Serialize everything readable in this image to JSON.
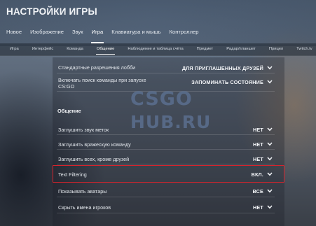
{
  "title": "НАСТРОЙКИ ИГРЫ",
  "tabs": [
    {
      "label": "Новое"
    },
    {
      "label": "Изображение"
    },
    {
      "label": "Звук"
    },
    {
      "label": "Игра"
    },
    {
      "label": "Клавиатура и мышь"
    },
    {
      "label": "Контроллер"
    }
  ],
  "active_tab": "Игра",
  "subtabs": [
    {
      "label": "Игра"
    },
    {
      "label": "Интерфейс"
    },
    {
      "label": "Команда"
    },
    {
      "label": "Общение"
    },
    {
      "label": "Наблюдение и таблица счёта"
    },
    {
      "label": "Предмет"
    },
    {
      "label": "Радар/планшет"
    },
    {
      "label": "Прицел"
    },
    {
      "label": "Twitch.tv"
    }
  ],
  "active_subtab": "Общение",
  "rows": [
    {
      "label": "Стандартные разрешения лобби",
      "value": "ДЛЯ ПРИГЛАШЕННЫХ ДРУЗЕЙ"
    },
    {
      "label": "Включать поиск команды при запуске CS:GO",
      "value": "ЗАПОМИНАТЬ СОСТОЯНИЕ"
    }
  ],
  "section": {
    "title": "Общение"
  },
  "comm_rows": [
    {
      "label": "Заглушить звук меток",
      "value": "НЕТ"
    },
    {
      "label": "Заглушить вражескую команду",
      "value": "НЕТ"
    },
    {
      "label": "Заглушить всех, кроме друзей",
      "value": "НЕТ"
    },
    {
      "label": "Text Filtering",
      "value": "ВКЛ."
    },
    {
      "label": "Показывать аватары",
      "value": "ВСЕ"
    },
    {
      "label": "Скрыть имена игроков",
      "value": "НЕТ"
    }
  ],
  "highlight_color": "#d7232c",
  "watermark": {
    "line1": "CSGO",
    "line2": "HUB.RU"
  },
  "icons": {
    "dropdown": "chevron-down-icon"
  }
}
